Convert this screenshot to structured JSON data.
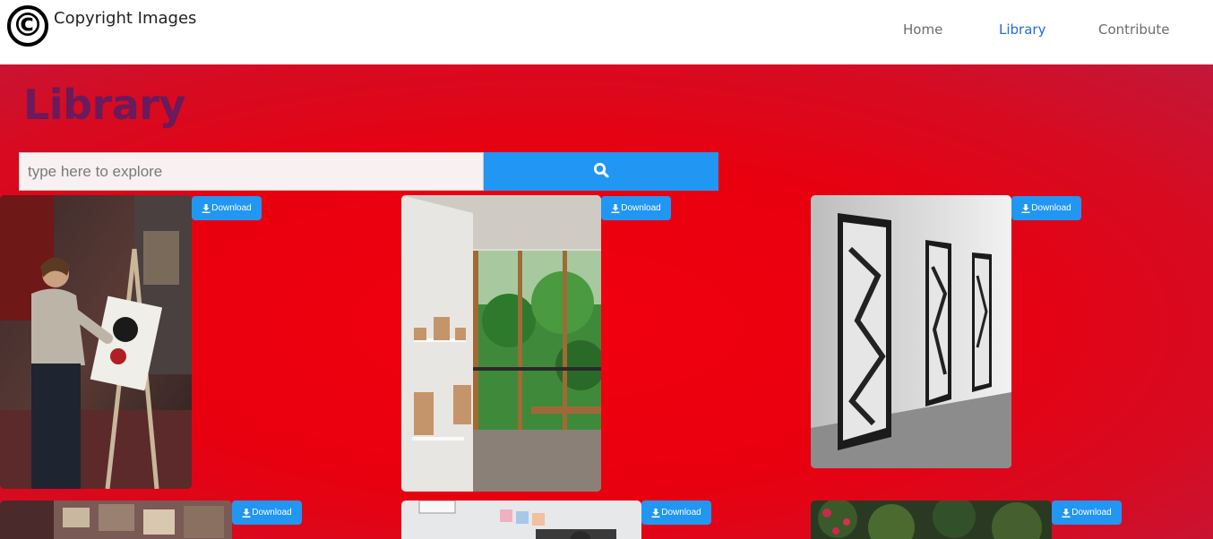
{
  "brand": {
    "logo_symbol": "©",
    "name": "Copyright Images"
  },
  "nav": {
    "items": [
      {
        "label": "Home",
        "active": false
      },
      {
        "label": "Library",
        "active": true
      },
      {
        "label": "Contribute",
        "active": false
      }
    ],
    "active_color": "#1e6bd6"
  },
  "page": {
    "title": "Library",
    "title_color": "#6b1a5c",
    "background_color": "#e8000f"
  },
  "search": {
    "placeholder": "type here to explore",
    "value": "",
    "button_icon": "search-icon",
    "button_color": "#2196f3"
  },
  "gallery": {
    "download_label": "Download",
    "download_icon": "download-icon",
    "items": [
      {
        "name": "artist-painting-photo",
        "description": "Woman painting on an easel in a studio"
      },
      {
        "name": "sunroom-window-photo",
        "description": "Bright room with framed pictures and tropical view"
      },
      {
        "name": "gallery-wall-photo",
        "description": "Black and white gallery with framed artworks"
      },
      {
        "name": "photo-collage-wall-photo",
        "description": "Wall of photos"
      },
      {
        "name": "office-desk-photo",
        "description": "Office interior"
      },
      {
        "name": "plants-photo",
        "description": "Green plants with flowers"
      }
    ]
  }
}
